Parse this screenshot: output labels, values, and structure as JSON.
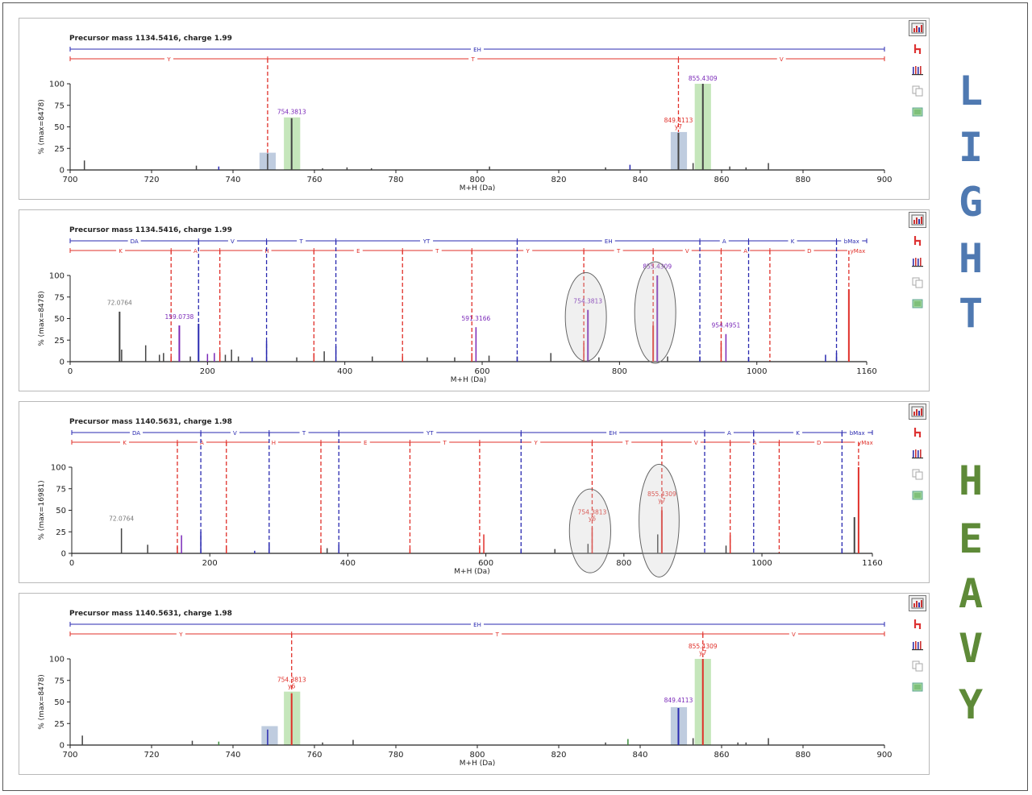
{
  "labels": {
    "light": "LIGHT",
    "heavy": "HEAVY"
  },
  "colors": {
    "light_label": "#4f79b1",
    "heavy_label": "#5e8a38",
    "y_ion": "#e0302a",
    "b_ion": "#2a2ab0",
    "peak_neutral": "#444444",
    "peak_purple": "#7a28b8",
    "highlight_blue": "#b8c6dc",
    "highlight_green": "#bfe3b4"
  },
  "toolbar_icons": [
    "spectrum-view-icon",
    "fragment-tree-icon",
    "ion-series-icon",
    "copy-icon",
    "export-image-icon"
  ],
  "chart_data": [
    {
      "type": "bar",
      "title": "Precursor mass 1134.5416, charge 1.99",
      "xlabel": "M+H (Da)",
      "ylabel": "% (max=8478)",
      "xlim": [
        700,
        900
      ],
      "ylim": [
        0,
        100
      ],
      "xticks": [
        "700",
        "720",
        "740",
        "760",
        "780",
        "800",
        "820",
        "840",
        "860",
        "880",
        "900"
      ],
      "yticks": [
        "0",
        "25",
        "50",
        "75",
        "100"
      ],
      "b_series": {
        "segments": [
          {
            "label": "EH",
            "from": 700,
            "to": 900
          }
        ],
        "markers": []
      },
      "y_series": {
        "segments": [
          {
            "label": "Y",
            "from": 700,
            "to": 748.5
          },
          {
            "label": "T",
            "from": 748.5,
            "to": 849.4
          },
          {
            "label": "V",
            "from": 849.4,
            "to": 900
          }
        ],
        "markers": [
          748.5,
          849.4
        ]
      },
      "highlights": [
        {
          "from": 746.5,
          "to": 750.5,
          "height": 20,
          "color": "blue"
        },
        {
          "from": 752.5,
          "to": 756.5,
          "height": 61,
          "color": "green"
        },
        {
          "from": 847.5,
          "to": 851.5,
          "height": 44,
          "color": "blue"
        },
        {
          "from": 853.4,
          "to": 857.4,
          "height": 100,
          "color": "green"
        }
      ],
      "peaks": [
        {
          "x": 703.5,
          "y": 11,
          "c": "n"
        },
        {
          "x": 731,
          "y": 5,
          "c": "n"
        },
        {
          "x": 736.5,
          "y": 4,
          "c": "b"
        },
        {
          "x": 748.5,
          "y": 19,
          "c": "n"
        },
        {
          "x": 754.4,
          "y": 60,
          "c": "n"
        },
        {
          "x": 762,
          "y": 2,
          "c": "n"
        },
        {
          "x": 768,
          "y": 3,
          "c": "n"
        },
        {
          "x": 774,
          "y": 2,
          "c": "n"
        },
        {
          "x": 803,
          "y": 4,
          "c": "n"
        },
        {
          "x": 831.5,
          "y": 3,
          "c": "n"
        },
        {
          "x": 837.5,
          "y": 6,
          "c": "b"
        },
        {
          "x": 849.4,
          "y": 43,
          "c": "n"
        },
        {
          "x": 853,
          "y": 8,
          "c": "n"
        },
        {
          "x": 855.4,
          "y": 100,
          "c": "n"
        },
        {
          "x": 862,
          "y": 4,
          "c": "n"
        },
        {
          "x": 866,
          "y": 3,
          "c": "n"
        },
        {
          "x": 871.5,
          "y": 8,
          "c": "n"
        }
      ],
      "annotations": [
        {
          "x": 754.4,
          "y": 61,
          "text": "754.3813",
          "color": "purple"
        },
        {
          "x": 849.4,
          "y": 44,
          "text": "849.4113",
          "sub": "y7",
          "color": "red"
        },
        {
          "x": 855.4,
          "y": 100,
          "text": "855.4309",
          "color": "purple"
        }
      ],
      "ellipses": []
    },
    {
      "type": "bar",
      "title": "Precursor mass 1134.5416, charge 1.99",
      "xlabel": "M+H (Da)",
      "ylabel": "% (max=8478)",
      "xlim": [
        0,
        1160
      ],
      "ylim": [
        0,
        100
      ],
      "xticks": [
        "0",
        "200",
        "400",
        "600",
        "800",
        "1000",
        "1160"
      ],
      "yticks": [
        "0",
        "25",
        "50",
        "75",
        "100"
      ],
      "b_series": {
        "segments": [
          {
            "label": "DA",
            "from": 0,
            "to": 187
          },
          {
            "label": "V",
            "from": 187,
            "to": 286
          },
          {
            "label": "T",
            "from": 286,
            "to": 387
          },
          {
            "label": "YT",
            "from": 387,
            "to": 651
          },
          {
            "label": "EH",
            "from": 651,
            "to": 917
          },
          {
            "label": "A",
            "from": 917,
            "to": 988
          },
          {
            "label": "K",
            "from": 988,
            "to": 1116
          },
          {
            "label": "bMax",
            "from": 1116,
            "to": 1160
          }
        ],
        "markers": [
          187,
          286,
          387,
          651,
          917,
          988,
          1116
        ]
      },
      "y_series": {
        "segments": [
          {
            "label": "K",
            "from": 0,
            "to": 147
          },
          {
            "label": "A",
            "from": 147,
            "to": 218
          },
          {
            "label": "H",
            "from": 218,
            "to": 355
          },
          {
            "label": "E",
            "from": 355,
            "to": 484
          },
          {
            "label": "T",
            "from": 484,
            "to": 585
          },
          {
            "label": "Y",
            "from": 585,
            "to": 748
          },
          {
            "label": "T",
            "from": 748,
            "to": 849
          },
          {
            "label": "V",
            "from": 849,
            "to": 948
          },
          {
            "label": "A",
            "from": 948,
            "to": 1019
          },
          {
            "label": "D",
            "from": 1019,
            "to": 1134
          },
          {
            "label": "yMax",
            "from": 1134,
            "to": 1160
          }
        ],
        "markers": [
          147,
          218,
          355,
          484,
          585,
          748,
          849,
          948,
          1019,
          1134
        ]
      },
      "highlights": [],
      "peaks": [
        {
          "x": 72,
          "y": 58,
          "c": "n"
        },
        {
          "x": 75,
          "y": 14,
          "c": "n"
        },
        {
          "x": 110,
          "y": 19,
          "c": "n"
        },
        {
          "x": 130,
          "y": 8,
          "c": "n"
        },
        {
          "x": 136,
          "y": 10,
          "c": "n"
        },
        {
          "x": 147,
          "y": 6,
          "c": "r"
        },
        {
          "x": 159,
          "y": 42,
          "c": "p"
        },
        {
          "x": 175,
          "y": 6,
          "c": "n"
        },
        {
          "x": 187,
          "y": 44,
          "c": "b"
        },
        {
          "x": 200,
          "y": 9,
          "c": "p"
        },
        {
          "x": 210,
          "y": 10,
          "c": "p"
        },
        {
          "x": 218,
          "y": 12,
          "c": "r"
        },
        {
          "x": 226,
          "y": 8,
          "c": "n"
        },
        {
          "x": 235,
          "y": 14,
          "c": "n"
        },
        {
          "x": 245,
          "y": 6,
          "c": "n"
        },
        {
          "x": 265,
          "y": 5,
          "c": "b"
        },
        {
          "x": 286,
          "y": 24,
          "c": "b"
        },
        {
          "x": 330,
          "y": 5,
          "c": "n"
        },
        {
          "x": 355,
          "y": 10,
          "c": "r"
        },
        {
          "x": 370,
          "y": 12,
          "c": "n"
        },
        {
          "x": 387,
          "y": 18,
          "c": "b"
        },
        {
          "x": 440,
          "y": 6,
          "c": "n"
        },
        {
          "x": 484,
          "y": 6,
          "c": "r"
        },
        {
          "x": 520,
          "y": 5,
          "c": "n"
        },
        {
          "x": 560,
          "y": 5,
          "c": "n"
        },
        {
          "x": 585,
          "y": 10,
          "c": "r"
        },
        {
          "x": 591,
          "y": 40,
          "c": "p"
        },
        {
          "x": 610,
          "y": 7,
          "c": "n"
        },
        {
          "x": 651,
          "y": 6,
          "c": "b"
        },
        {
          "x": 700,
          "y": 10,
          "c": "n"
        },
        {
          "x": 748,
          "y": 22,
          "c": "r"
        },
        {
          "x": 754,
          "y": 60,
          "c": "p"
        },
        {
          "x": 770,
          "y": 5,
          "c": "n"
        },
        {
          "x": 849,
          "y": 42,
          "c": "r"
        },
        {
          "x": 855,
          "y": 100,
          "c": "p"
        },
        {
          "x": 870,
          "y": 6,
          "c": "n"
        },
        {
          "x": 917,
          "y": 6,
          "c": "b"
        },
        {
          "x": 948,
          "y": 22,
          "c": "r"
        },
        {
          "x": 955,
          "y": 32,
          "c": "p"
        },
        {
          "x": 988,
          "y": 5,
          "c": "b"
        },
        {
          "x": 1100,
          "y": 8,
          "c": "b"
        },
        {
          "x": 1116,
          "y": 10,
          "c": "b"
        },
        {
          "x": 1134,
          "y": 84,
          "c": "r"
        }
      ],
      "annotations": [
        {
          "x": 72,
          "y": 62,
          "text": "72.0764",
          "color": "gray"
        },
        {
          "x": 159,
          "y": 46,
          "text": "159.0738",
          "color": "purple"
        },
        {
          "x": 591,
          "y": 44,
          "text": "591.3166",
          "color": "purple"
        },
        {
          "x": 754,
          "y": 64,
          "text": "754.3813",
          "color": "purple"
        },
        {
          "x": 855,
          "y": 104,
          "text": "855.4309",
          "color": "purple"
        },
        {
          "x": 955,
          "y": 36,
          "text": "954.4951",
          "color": "purple"
        }
      ],
      "ellipses": [
        {
          "cx": 751,
          "cy": 52,
          "rx": 34,
          "ry": 55
        },
        {
          "cx": 852,
          "cy": 57,
          "rx": 34,
          "ry": 63
        }
      ]
    },
    {
      "type": "bar",
      "title": "Precursor mass 1140.5631, charge 1.98",
      "xlabel": "M+H (Da)",
      "ylabel": "% (max=16981)",
      "xlim": [
        0,
        1160
      ],
      "ylim": [
        0,
        100
      ],
      "xticks": [
        "0",
        "200",
        "400",
        "600",
        "800",
        "1000",
        "1160"
      ],
      "yticks": [
        "0",
        "25",
        "50",
        "75",
        "100"
      ],
      "b_series": {
        "segments": [
          {
            "label": "DA",
            "from": 0,
            "to": 187
          },
          {
            "label": "V",
            "from": 187,
            "to": 286
          },
          {
            "label": "T",
            "from": 286,
            "to": 387
          },
          {
            "label": "YT",
            "from": 387,
            "to": 651
          },
          {
            "label": "EH",
            "from": 651,
            "to": 917
          },
          {
            "label": "A",
            "from": 917,
            "to": 988
          },
          {
            "label": "K",
            "from": 988,
            "to": 1116
          },
          {
            "label": "bMax",
            "from": 1116,
            "to": 1160
          }
        ],
        "markers": [
          187,
          286,
          387,
          651,
          917,
          988,
          1116
        ]
      },
      "y_series": {
        "segments": [
          {
            "label": "K",
            "from": 0,
            "to": 153
          },
          {
            "label": "A",
            "from": 153,
            "to": 224
          },
          {
            "label": "H",
            "from": 224,
            "to": 361
          },
          {
            "label": "E",
            "from": 361,
            "to": 490
          },
          {
            "label": "T",
            "from": 490,
            "to": 591
          },
          {
            "label": "Y",
            "from": 591,
            "to": 754
          },
          {
            "label": "T",
            "from": 754,
            "to": 855
          },
          {
            "label": "V",
            "from": 855,
            "to": 954
          },
          {
            "label": "A",
            "from": 954,
            "to": 1025
          },
          {
            "label": "D",
            "from": 1025,
            "to": 1140
          },
          {
            "label": "yMax",
            "from": 1140,
            "to": 1160
          }
        ],
        "markers": [
          153,
          224,
          361,
          490,
          591,
          754,
          855,
          954,
          1025,
          1140
        ]
      },
      "highlights": [],
      "peaks": [
        {
          "x": 72,
          "y": 29,
          "c": "n"
        },
        {
          "x": 110,
          "y": 10,
          "c": "n"
        },
        {
          "x": 153,
          "y": 8,
          "c": "r"
        },
        {
          "x": 159,
          "y": 21,
          "c": "p"
        },
        {
          "x": 187,
          "y": 25,
          "c": "b"
        },
        {
          "x": 224,
          "y": 9,
          "c": "r"
        },
        {
          "x": 265,
          "y": 3,
          "c": "b"
        },
        {
          "x": 286,
          "y": 12,
          "c": "b"
        },
        {
          "x": 361,
          "y": 6,
          "c": "r"
        },
        {
          "x": 370,
          "y": 6,
          "c": "n"
        },
        {
          "x": 387,
          "y": 10,
          "c": "b"
        },
        {
          "x": 490,
          "y": 5,
          "c": "r"
        },
        {
          "x": 591,
          "y": 7,
          "c": "r"
        },
        {
          "x": 597,
          "y": 22,
          "c": "r"
        },
        {
          "x": 651,
          "y": 4,
          "c": "b"
        },
        {
          "x": 700,
          "y": 5,
          "c": "n"
        },
        {
          "x": 748,
          "y": 11,
          "c": "n"
        },
        {
          "x": 754,
          "y": 30,
          "c": "r"
        },
        {
          "x": 849,
          "y": 22,
          "c": "n"
        },
        {
          "x": 855,
          "y": 50,
          "c": "r"
        },
        {
          "x": 948,
          "y": 9,
          "c": "n"
        },
        {
          "x": 954,
          "y": 21,
          "c": "r"
        },
        {
          "x": 1116,
          "y": 6,
          "c": "b"
        },
        {
          "x": 1134,
          "y": 42,
          "c": "n"
        },
        {
          "x": 1140,
          "y": 100,
          "c": "r"
        }
      ],
      "annotations": [
        {
          "x": 72,
          "y": 34,
          "text": "72.0764",
          "color": "gray"
        },
        {
          "x": 754,
          "y": 34,
          "text": "754.3813",
          "sub": "y6",
          "color": "red"
        },
        {
          "x": 855,
          "y": 55,
          "text": "855.4309",
          "sub": "y7",
          "color": "red"
        }
      ],
      "ellipses": [
        {
          "cx": 751,
          "cy": 26,
          "rx": 34,
          "ry": 52
        },
        {
          "cx": 851,
          "cy": 38,
          "rx": 33,
          "ry": 70
        }
      ]
    },
    {
      "type": "bar",
      "title": "Precursor mass 1140.5631, charge 1.98",
      "xlabel": "M+H (Da)",
      "ylabel": "% (max=8478)",
      "xlim": [
        700,
        900
      ],
      "ylim": [
        0,
        100
      ],
      "xticks": [
        "700",
        "720",
        "740",
        "760",
        "780",
        "800",
        "820",
        "840",
        "860",
        "880",
        "900"
      ],
      "yticks": [
        "0",
        "25",
        "50",
        "75",
        "100"
      ],
      "b_series": {
        "segments": [
          {
            "label": "EH",
            "from": 700,
            "to": 900
          }
        ],
        "markers": []
      },
      "y_series": {
        "segments": [
          {
            "label": "Y",
            "from": 700,
            "to": 754.4
          },
          {
            "label": "T",
            "from": 754.4,
            "to": 855.4
          },
          {
            "label": "V",
            "from": 855.4,
            "to": 900
          }
        ],
        "markers": [
          754.4,
          855.4
        ]
      },
      "highlights": [
        {
          "from": 747,
          "to": 751,
          "height": 22,
          "color": "blue"
        },
        {
          "from": 752.5,
          "to": 756.5,
          "height": 62,
          "color": "green"
        },
        {
          "from": 847.5,
          "to": 851.5,
          "height": 44,
          "color": "blue"
        },
        {
          "from": 853.4,
          "to": 857.4,
          "height": 100,
          "color": "green"
        }
      ],
      "peaks": [
        {
          "x": 703,
          "y": 11,
          "c": "n"
        },
        {
          "x": 730,
          "y": 5,
          "c": "n"
        },
        {
          "x": 736.5,
          "y": 4,
          "c": "g"
        },
        {
          "x": 748.5,
          "y": 18,
          "c": "b"
        },
        {
          "x": 754.4,
          "y": 60,
          "c": "r"
        },
        {
          "x": 762,
          "y": 3,
          "c": "n"
        },
        {
          "x": 769.5,
          "y": 6,
          "c": "n"
        },
        {
          "x": 831.5,
          "y": 3,
          "c": "n"
        },
        {
          "x": 837,
          "y": 7,
          "c": "g"
        },
        {
          "x": 849.4,
          "y": 43,
          "c": "b"
        },
        {
          "x": 853,
          "y": 8,
          "c": "n"
        },
        {
          "x": 855.4,
          "y": 100,
          "c": "r"
        },
        {
          "x": 864,
          "y": 3,
          "c": "n"
        },
        {
          "x": 866,
          "y": 3,
          "c": "n"
        },
        {
          "x": 871.5,
          "y": 8,
          "c": "n"
        }
      ],
      "annotations": [
        {
          "x": 754.4,
          "y": 62,
          "text": "754.3813",
          "sub": "y6",
          "color": "red"
        },
        {
          "x": 849.4,
          "y": 46,
          "text": "849.4113",
          "color": "purple"
        },
        {
          "x": 855.4,
          "y": 101,
          "text": "855.4309",
          "sub": "y7",
          "color": "red"
        }
      ],
      "ellipses": []
    }
  ]
}
